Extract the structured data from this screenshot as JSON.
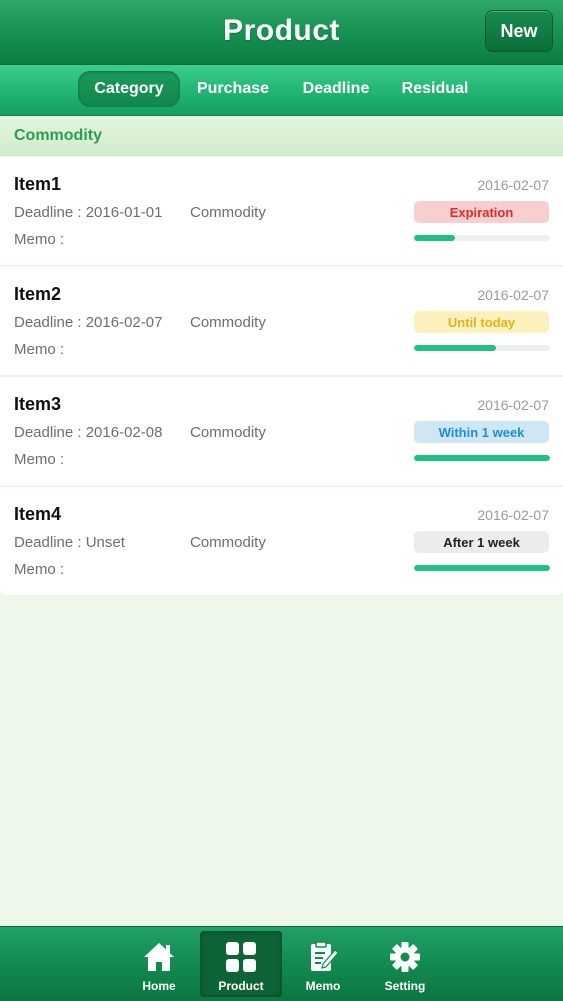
{
  "header": {
    "title": "Product",
    "new_label": "New"
  },
  "tabs": [
    {
      "label": "Category",
      "active": true
    },
    {
      "label": "Purchase",
      "active": false
    },
    {
      "label": "Deadline",
      "active": false
    },
    {
      "label": "Residual",
      "active": false
    }
  ],
  "section": {
    "title": "Commodity"
  },
  "items": [
    {
      "name": "Item1",
      "date": "2016-02-07",
      "deadline": "Deadline : 2016-01-01",
      "category": "Commodity",
      "memo": "Memo :",
      "status": "Expiration",
      "status_color": "#e02b2b",
      "status_bg": "#f8cfcf",
      "progress": 0.3
    },
    {
      "name": "Item2",
      "date": "2016-02-07",
      "deadline": "Deadline : 2016-02-07",
      "category": "Commodity",
      "memo": "Memo :",
      "status": "Until today",
      "status_color": "#e0b419",
      "status_bg": "#fbf1bd",
      "progress": 0.6
    },
    {
      "name": "Item3",
      "date": "2016-02-07",
      "deadline": "Deadline : 2016-02-08",
      "category": "Commodity",
      "memo": "Memo :",
      "status": "Within 1 week",
      "status_color": "#1d8fd6",
      "status_bg": "#cfe6f4",
      "progress": 1.0
    },
    {
      "name": "Item4",
      "date": "2016-02-07",
      "deadline": "Deadline : Unset",
      "category": "Commodity",
      "memo": "Memo :",
      "status": "After 1 week",
      "status_color": "#222222",
      "status_bg": "#ececec",
      "progress": 1.0
    }
  ],
  "tabbar": [
    {
      "label": "Home",
      "icon": "home-icon",
      "active": false
    },
    {
      "label": "Product",
      "icon": "grid-icon",
      "active": true
    },
    {
      "label": "Memo",
      "icon": "memo-icon",
      "active": false
    },
    {
      "label": "Setting",
      "icon": "gear-icon",
      "active": false
    }
  ],
  "colors": {
    "accent": "#159051",
    "progress": "#1fc283",
    "section_text": "#2a9d56"
  }
}
